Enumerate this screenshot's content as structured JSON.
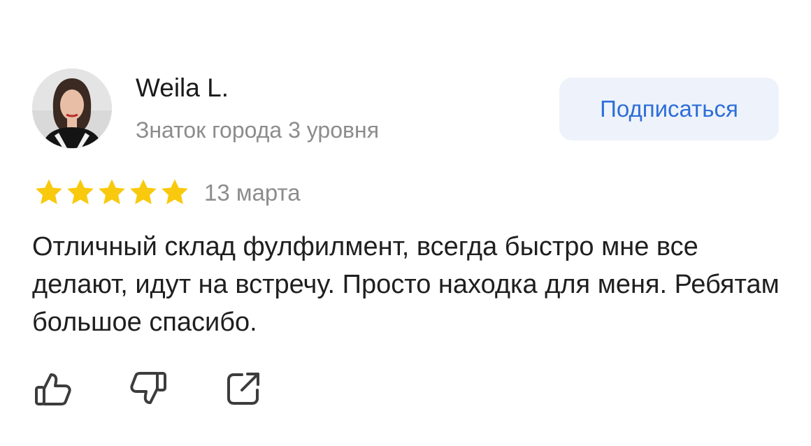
{
  "review": {
    "author": {
      "name": "Weila L.",
      "level": "Знаток города 3 уровня"
    },
    "subscribe_label": "Подписаться",
    "rating": {
      "value": 5,
      "max": 5,
      "star_color": "#f9c90d"
    },
    "date": "13 марта",
    "text": "Отличный склад фулфилмент, всегда быстро мне все делают, идут на встречу. Просто находка для меня. Ребятам большое спасибо.",
    "actions": {
      "like_icon": "thumbs-up-icon",
      "dislike_icon": "thumbs-down-icon",
      "share_icon": "share-icon"
    }
  },
  "colors": {
    "accent": "#2f6ed8",
    "button_bg": "#eef3fb",
    "muted_text": "#8c8c8c"
  }
}
